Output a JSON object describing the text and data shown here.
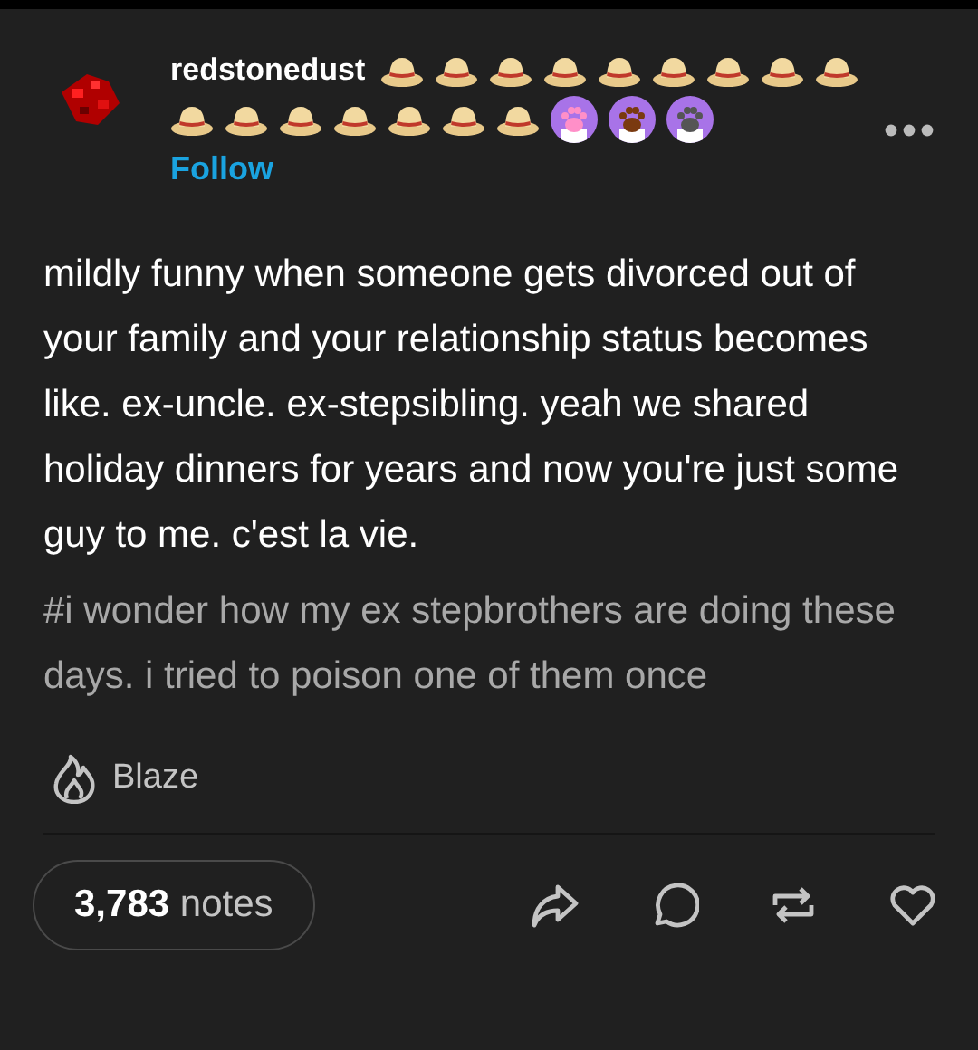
{
  "post": {
    "username": "redstonedust",
    "follow": "Follow",
    "badges": [
      {
        "kind": "hat"
      },
      {
        "kind": "hat"
      },
      {
        "kind": "hat"
      },
      {
        "kind": "hat"
      },
      {
        "kind": "hat"
      },
      {
        "kind": "hat"
      },
      {
        "kind": "hat"
      },
      {
        "kind": "hat"
      },
      {
        "kind": "hat"
      },
      {
        "kind": "hat"
      },
      {
        "kind": "hat"
      },
      {
        "kind": "hat"
      },
      {
        "kind": "hat"
      },
      {
        "kind": "hat"
      },
      {
        "kind": "hat"
      },
      {
        "kind": "hat"
      },
      {
        "kind": "paw",
        "color": "#ff8fc8"
      },
      {
        "kind": "paw",
        "color": "#7a3a10"
      },
      {
        "kind": "paw",
        "color": "#555555"
      }
    ],
    "body": "mildly funny when someone gets divorced out of your family and your relationship status becomes like. ex-uncle. ex-stepsibling. yeah we shared holiday dinners for years and now you're just some guy to me. c'est la vie.",
    "tag": "#i wonder how my ex stepbrothers are doing these days. i tried to poison one of them once",
    "blaze": "Blaze",
    "notes_count": "3,783",
    "notes_label": "notes"
  }
}
